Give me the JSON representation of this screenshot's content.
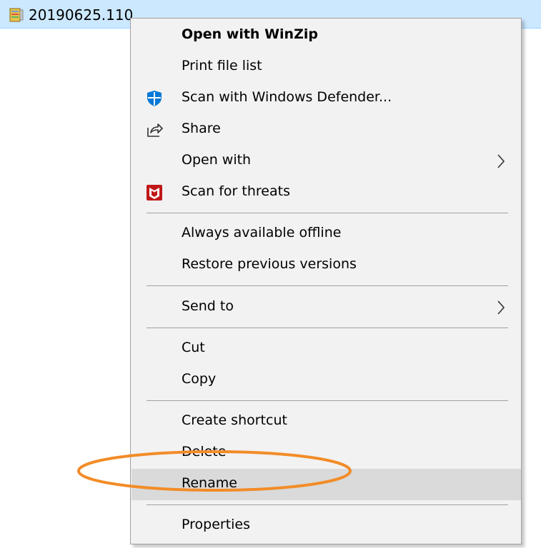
{
  "file": {
    "name": "20190625.110",
    "icon": "winzip-archive-icon"
  },
  "menu": {
    "items": [
      {
        "label": "Open with WinZip",
        "bold": true
      },
      {
        "label": "Print file list"
      },
      {
        "label": "Scan with Windows Defender...",
        "icon": "windows-defender-icon"
      },
      {
        "label": "Share",
        "icon": "share-icon"
      },
      {
        "label": "Open with",
        "submenu": true
      },
      {
        "label": "Scan for threats",
        "icon": "mcafee-icon"
      },
      {
        "label": "Always available offline"
      },
      {
        "label": "Restore previous versions"
      },
      {
        "label": "Send to",
        "submenu": true
      },
      {
        "label": "Cut"
      },
      {
        "label": "Copy"
      },
      {
        "label": "Create shortcut"
      },
      {
        "label": "Delete"
      },
      {
        "label": "Rename",
        "highlighted": true
      },
      {
        "label": "Properties"
      }
    ]
  },
  "annotation": {
    "color": "#f28c28",
    "shape": "ellipse",
    "target": "Rename"
  },
  "colors": {
    "selection": "#cce8ff",
    "menu_background": "#f2f2f2",
    "hover": "#dadada",
    "defender_blue": "#0078d7",
    "mcafee_red": "#c01818"
  }
}
